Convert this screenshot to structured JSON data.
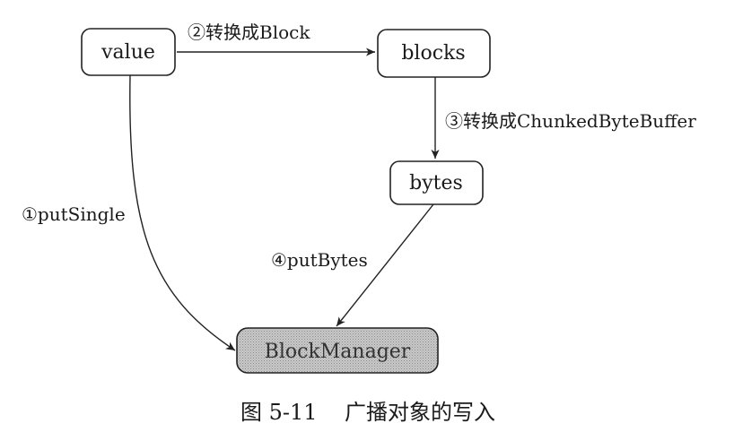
{
  "diagram": {
    "nodes": {
      "value": "value",
      "blocks": "blocks",
      "bytes": "bytes",
      "block_manager": "BlockManager"
    },
    "edges": {
      "value_to_blocks": "②转换成Block",
      "blocks_to_bytes": "③转换成ChunkedByteBuffer",
      "value_to_manager": "①putSingle",
      "bytes_to_manager": "④putBytes"
    }
  },
  "caption": "图 5-11    广播对象的写入"
}
